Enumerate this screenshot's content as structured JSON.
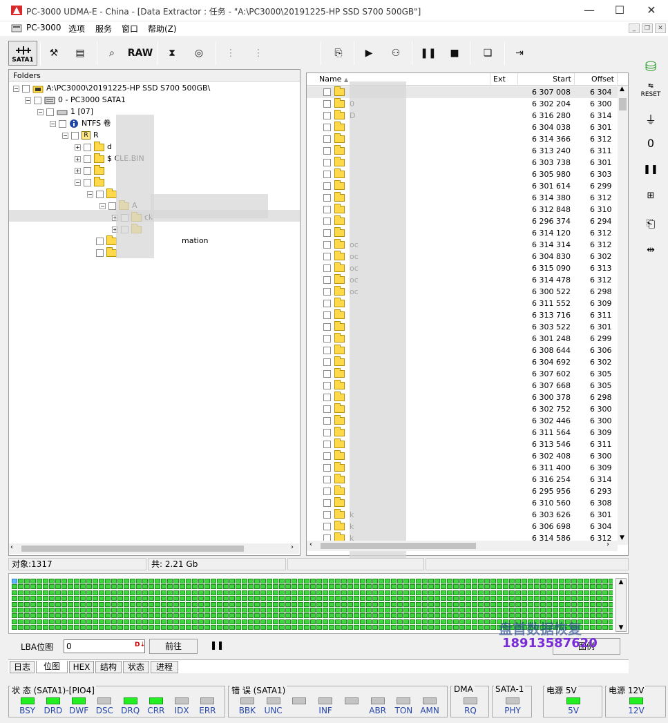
{
  "window": {
    "title": "PC-3000 UDMA-E - China - [Data Extractor : 任务 - \"A:\\PC3000\\20191225-HP SSD S700 500GB\"]"
  },
  "menu": [
    "PC-3000",
    "选项",
    "服务",
    "窗口",
    "帮助(Z)"
  ],
  "toolbar": {
    "sata_label": "SATA1",
    "raw_label": "RAW"
  },
  "folders": {
    "header": "Folders",
    "rows": [
      {
        "label": "A:\\PC3000\\20191225-HP SSD S700 500GB\\"
      },
      {
        "label": "0 - PC3000 SATA1"
      },
      {
        "label": "1 [07]"
      },
      {
        "label": "NTFS 卷"
      },
      {
        "label": "R"
      },
      {
        "label": "d"
      },
      {
        "label": "$ CLE.BIN"
      },
      {
        "label": ""
      },
      {
        "label": ""
      },
      {
        "label": ""
      },
      {
        "label": "A"
      },
      {
        "label": "ck"
      },
      {
        "label": ""
      },
      {
        "label": "mation"
      },
      {
        "label": ""
      }
    ]
  },
  "files": {
    "columns": [
      "Name",
      "Ext",
      "Start",
      "Offset"
    ],
    "rows": [
      {
        "name": "",
        "start": "6 307 008",
        "offset": "6 304"
      },
      {
        "name": "0",
        "start": "6 302 204",
        "offset": "6 300"
      },
      {
        "name": "D",
        "start": "6 316 280",
        "offset": "6 314"
      },
      {
        "name": "",
        "start": "6 304 038",
        "offset": "6 301"
      },
      {
        "name": "",
        "start": "6 314 366",
        "offset": "6 312"
      },
      {
        "name": "",
        "start": "6 313 240",
        "offset": "6 311"
      },
      {
        "name": "",
        "start": "6 303 738",
        "offset": "6 301"
      },
      {
        "name": "",
        "start": "6 305 980",
        "offset": "6 303"
      },
      {
        "name": "",
        "start": "6 301 614",
        "offset": "6 299"
      },
      {
        "name": "",
        "start": "6 314 380",
        "offset": "6 312"
      },
      {
        "name": "",
        "start": "6 312 848",
        "offset": "6 310"
      },
      {
        "name": "",
        "start": "6 296 374",
        "offset": "6 294"
      },
      {
        "name": "",
        "start": "6 314 120",
        "offset": "6 312"
      },
      {
        "name": "oc",
        "start": "6 314 314",
        "offset": "6 312"
      },
      {
        "name": "oc",
        "start": "6 304 830",
        "offset": "6 302"
      },
      {
        "name": "oc",
        "start": "6 315 090",
        "offset": "6 313"
      },
      {
        "name": "oc",
        "start": "6 314 478",
        "offset": "6 312"
      },
      {
        "name": "oc",
        "start": "6 300 522",
        "offset": "6 298"
      },
      {
        "name": "",
        "start": "6 311 552",
        "offset": "6 309"
      },
      {
        "name": "",
        "start": "6 313 716",
        "offset": "6 311"
      },
      {
        "name": "",
        "start": "6 303 522",
        "offset": "6 301"
      },
      {
        "name": "",
        "start": "6 301 248",
        "offset": "6 299"
      },
      {
        "name": "",
        "start": "6 308 644",
        "offset": "6 306"
      },
      {
        "name": "",
        "start": "6 304 692",
        "offset": "6 302"
      },
      {
        "name": "",
        "start": "6 307 602",
        "offset": "6 305"
      },
      {
        "name": "",
        "start": "6 307 668",
        "offset": "6 305"
      },
      {
        "name": "",
        "start": "6 300 378",
        "offset": "6 298"
      },
      {
        "name": "",
        "start": "6 302 752",
        "offset": "6 300"
      },
      {
        "name": "",
        "start": "6 302 446",
        "offset": "6 300"
      },
      {
        "name": "",
        "start": "6 311 564",
        "offset": "6 309"
      },
      {
        "name": "",
        "start": "6 313 546",
        "offset": "6 311"
      },
      {
        "name": "",
        "start": "6 302 408",
        "offset": "6 300"
      },
      {
        "name": "",
        "start": "6 311 400",
        "offset": "6 309"
      },
      {
        "name": "",
        "start": "6 316 254",
        "offset": "6 314"
      },
      {
        "name": "",
        "start": "6 295 956",
        "offset": "6 293"
      },
      {
        "name": "",
        "start": "6 310 560",
        "offset": "6 308"
      },
      {
        "name": "k",
        "start": "6 303 626",
        "offset": "6 301"
      },
      {
        "name": "k",
        "start": "6 306 698",
        "offset": "6 304"
      },
      {
        "name": "k",
        "start": "6 314 586",
        "offset": "6 312"
      }
    ]
  },
  "status": {
    "objects": "对象:1317",
    "total": "共: 2.21 Gb"
  },
  "lba": {
    "label": "LBA位图",
    "value": "0",
    "go_label": "前往",
    "legend_label": "图例"
  },
  "watermark": {
    "text": "盘首数据恢复",
    "phone": "18913587620"
  },
  "tabs": [
    "日志",
    "位图",
    "HEX",
    "结构",
    "状态",
    "进程"
  ],
  "status_groups": [
    {
      "title": "状 态 (SATA1)-[PIO4]",
      "leds": [
        {
          "label": "BSY",
          "on": true
        },
        {
          "label": "DRD",
          "on": true
        },
        {
          "label": "DWF",
          "on": true
        },
        {
          "label": "DSC",
          "on": false
        },
        {
          "label": "DRQ",
          "on": true
        },
        {
          "label": "CRR",
          "on": true
        },
        {
          "label": "IDX",
          "on": false
        },
        {
          "label": "ERR",
          "on": false
        }
      ]
    },
    {
      "title": "错 误 (SATA1)",
      "leds": [
        {
          "label": "BBK",
          "on": false
        },
        {
          "label": "UNC",
          "on": false
        },
        {
          "label": "",
          "on": false
        },
        {
          "label": "INF",
          "on": false
        },
        {
          "label": "",
          "on": false
        },
        {
          "label": "ABR",
          "on": false
        },
        {
          "label": "TON",
          "on": false
        },
        {
          "label": "AMN",
          "on": false
        }
      ]
    },
    {
      "title": "DMA",
      "leds": [
        {
          "label": "RQ",
          "on": false
        }
      ]
    },
    {
      "title": "SATA-1",
      "leds": [
        {
          "label": "PHY",
          "on": false
        }
      ]
    },
    {
      "title": "电源 5V",
      "leds": [
        {
          "label": "5V",
          "on": true
        }
      ]
    },
    {
      "title": "电源 12V",
      "leds": [
        {
          "label": "12V",
          "on": true
        }
      ]
    }
  ],
  "colors": {
    "led_on": "#22ee22",
    "led_off": "#c4c4c4",
    "map_cell": "#3ed53e",
    "accent_label": "#2646a8"
  }
}
